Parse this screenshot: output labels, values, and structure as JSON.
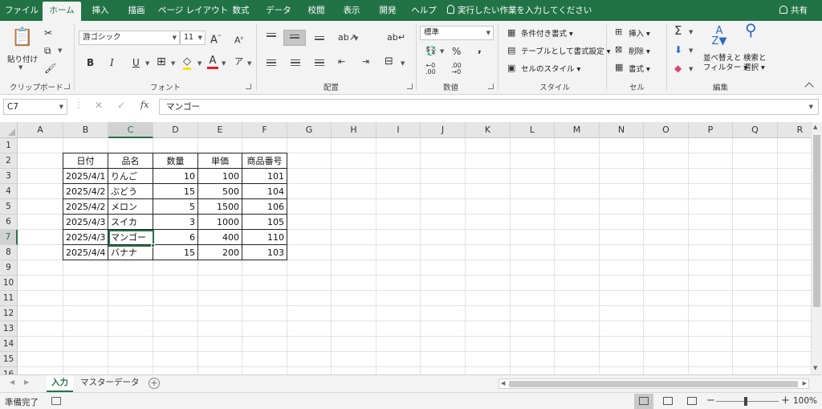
{
  "tabs": [
    "ファイル",
    "ホーム",
    "挿入",
    "描画",
    "ページ レイアウト",
    "数式",
    "データ",
    "校閲",
    "表示",
    "開発",
    "ヘルプ"
  ],
  "active_tab": "ホーム",
  "tell_me": "実行したい作業を入力してください",
  "share": "共有",
  "ribbon": {
    "clipboard": {
      "paste": "貼り付け",
      "group": "クリップボード"
    },
    "font": {
      "name": "游ゴシック",
      "size": "11",
      "bold": "B",
      "italic": "I",
      "underline": "U",
      "group": "フォント"
    },
    "alignment": {
      "group": "配置"
    },
    "number": {
      "format": "標準",
      "percent": "%",
      "comma": ",",
      "group": "数値"
    },
    "styles": {
      "conditional": "条件付き書式",
      "table": "テーブルとして書式設定",
      "cell_styles": "セルのスタイル",
      "group": "スタイル"
    },
    "cells": {
      "insert": "挿入",
      "delete": "削除",
      "format": "書式",
      "group": "セル"
    },
    "editing": {
      "sort1": "並べ替えと",
      "sort2": "フィルター",
      "find1": "検索と",
      "find2": "選択",
      "group": "編集"
    }
  },
  "formula_bar": {
    "name_box": "C7",
    "content": "マンゴー",
    "fx": "fx"
  },
  "columns": [
    "A",
    "B",
    "C",
    "D",
    "E",
    "F",
    "G",
    "H",
    "I",
    "J",
    "K",
    "L",
    "M",
    "N",
    "O",
    "P",
    "Q",
    "R"
  ],
  "active_column": "C",
  "rows": [
    "1",
    "2",
    "3",
    "4",
    "5",
    "6",
    "7",
    "8",
    "9",
    "10",
    "11",
    "12",
    "13",
    "14",
    "15",
    "16"
  ],
  "active_row": "7",
  "table": {
    "headers": [
      "日付",
      "品名",
      "数量",
      "単価",
      "商品番号"
    ],
    "rows": [
      [
        "2025/4/1",
        "りんご",
        "10",
        "100",
        "101"
      ],
      [
        "2025/4/2",
        "ぶどう",
        "15",
        "500",
        "104"
      ],
      [
        "2025/4/2",
        "メロン",
        "5",
        "1500",
        "106"
      ],
      [
        "2025/4/3",
        "スイカ",
        "3",
        "1000",
        "105"
      ],
      [
        "2025/4/3",
        "マンゴー",
        "6",
        "400",
        "110"
      ],
      [
        "2025/4/4",
        "バナナ",
        "15",
        "200",
        "103"
      ]
    ]
  },
  "sheets": [
    "入力",
    "マスターデータ"
  ],
  "active_sheet": "入力",
  "status": "準備完了",
  "zoom": "100%",
  "accent_color": "#217346"
}
